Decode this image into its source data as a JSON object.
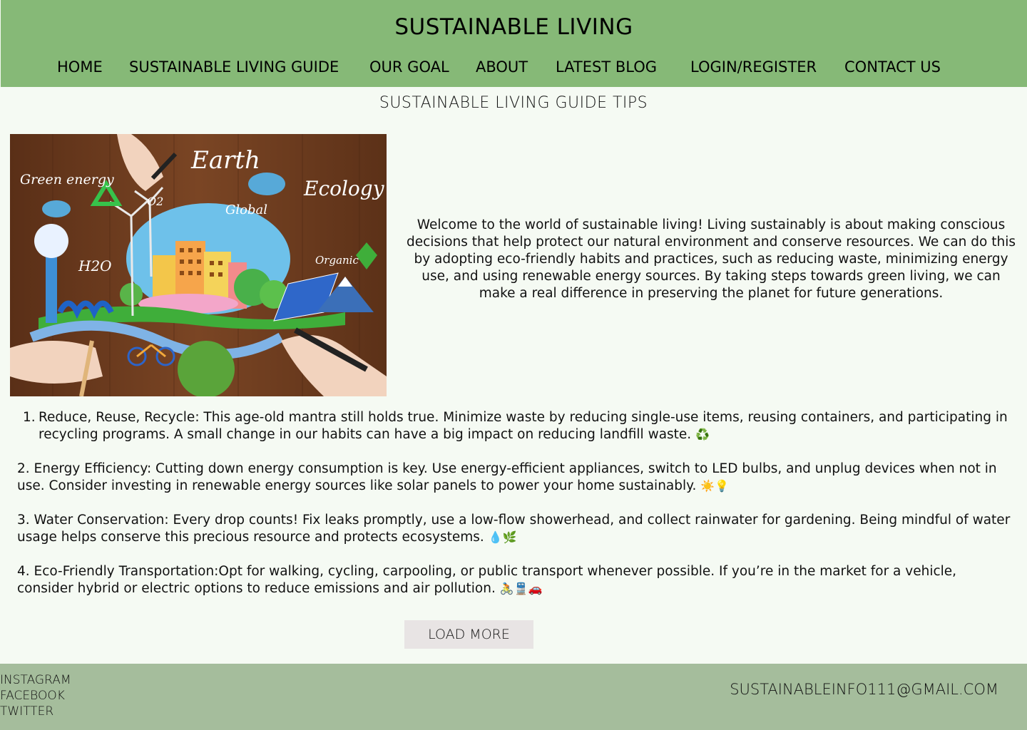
{
  "header": {
    "title": "SUSTAINABLE LIVING",
    "nav": [
      {
        "label": "HOME"
      },
      {
        "label": "SUSTAINABLE LIVING GUIDE"
      },
      {
        "label": "OUR GOAL"
      },
      {
        "label": "ABOUT"
      },
      {
        "label": "LATEST BLOG"
      },
      {
        "label": "LOGIN/REGISTER"
      },
      {
        "label": "CONTACT US"
      }
    ]
  },
  "main": {
    "heading": "SUSTAINABLE LIVING GUIDE TIPS",
    "image": {
      "labels": [
        "Green energy",
        "Earth",
        "Ecology",
        "O2",
        "Global",
        "H2O",
        "Organic"
      ]
    },
    "intro": "Welcome to the world of sustainable living! Living sustainably is about making conscious decisions that help protect our natural environment and conserve resources. We can do this by adopting eco-friendly habits and practices, such as reducing waste, minimizing energy use, and using renewable energy sources. By taking steps towards green living, we can make a real difference in preserving the planet for future generations.",
    "tips": [
      {
        "number": "1.",
        "text": "Reduce, Reuse, Recycle: This age-old mantra still holds true. Minimize waste by reducing single-use items, reusing containers, and participating in recycling programs. A small change in our habits can have a big impact on reducing landfill waste.",
        "emoji": "♻️"
      },
      {
        "text": "2. Energy Efficiency: Cutting down energy consumption is key. Use energy-efficient appliances, switch to LED bulbs, and unplug devices when not in use. Consider investing in renewable energy sources like solar panels to power your home sustainably.",
        "emoji": "☀️💡"
      },
      {
        "text": "3. Water Conservation: Every drop counts! Fix leaks promptly, use a low-flow showerhead, and collect rainwater for gardening. Being mindful of water usage helps conserve this precious resource and protects ecosystems.",
        "emoji": "💧🌿"
      },
      {
        "text": "4. Eco-Friendly Transportation:Opt for walking, cycling, carpooling, or public transport whenever possible. If you’re in the market for a vehicle, consider hybrid or electric options to reduce emissions and air pollution.",
        "emoji": "🚴🚆🚗"
      }
    ],
    "load_more": "LOAD MORE"
  },
  "footer": {
    "social": [
      "INSTAGRAM",
      "FACEBOOK",
      "TWITTER"
    ],
    "email": "SUSTAINABLEINFO111@GMAIL.COM"
  },
  "colors": {
    "header_bg": "#86b977",
    "page_bg": "#f5faf3",
    "footer_bg": "#a5bd9c",
    "button_bg": "#e8e4e4"
  }
}
